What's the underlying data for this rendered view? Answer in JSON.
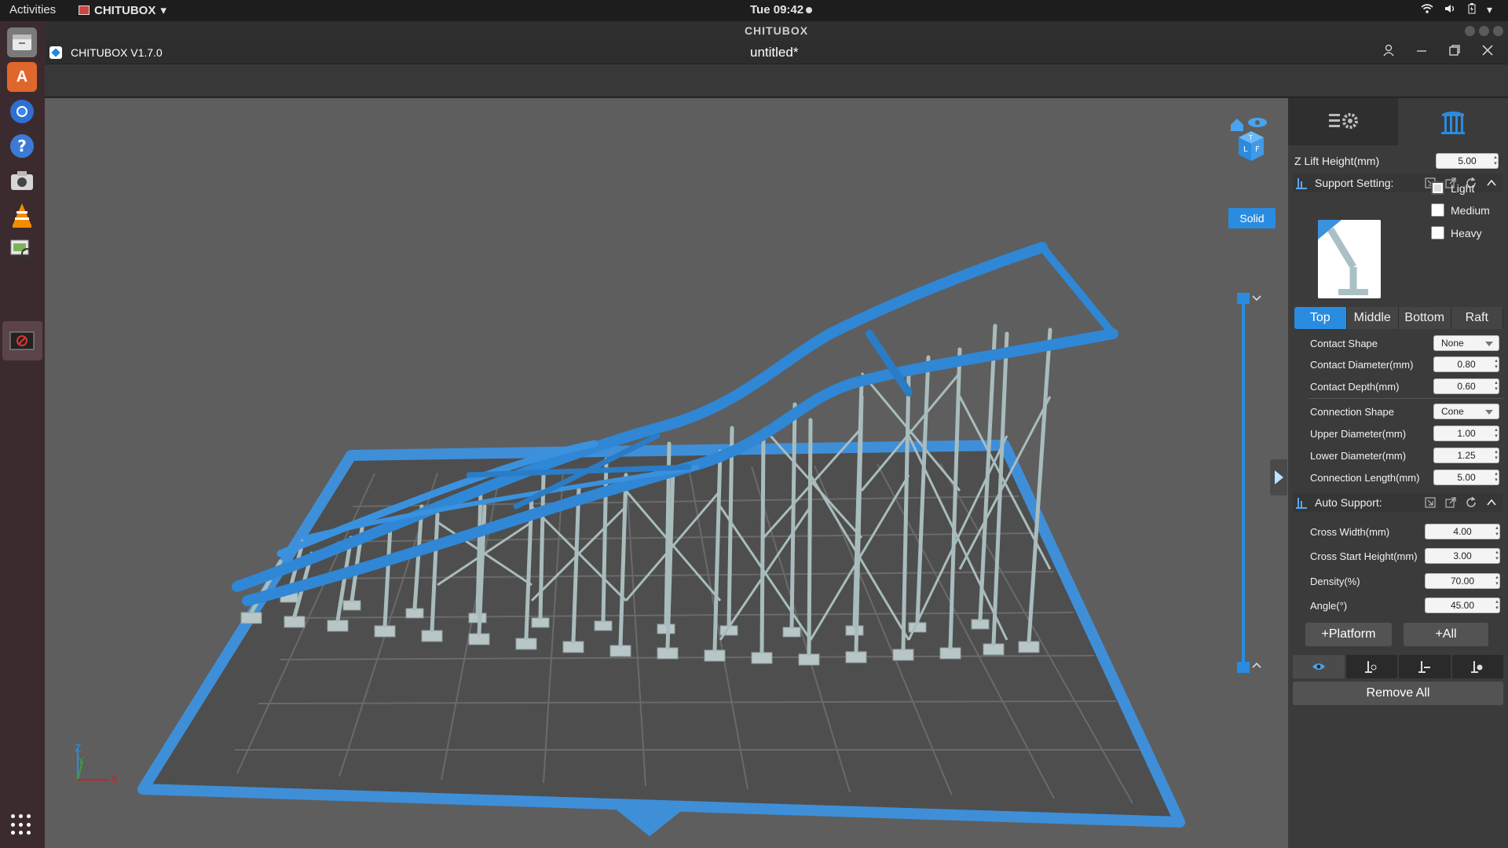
{
  "topbar": {
    "activities": "Activities",
    "app_menu": "CHITUBOX",
    "clock": "Tue 09:42"
  },
  "window": {
    "title": "CHITUBOX"
  },
  "app": {
    "name": "CHITUBOX V1.7.0",
    "document": "untitled*"
  },
  "viewport": {
    "render_mode": "Solid",
    "axis_z": "Z",
    "axis_y": "Y",
    "axis_x": "X",
    "accent_color": "#2a8ce0",
    "support_color": "#a9bcbd",
    "model_color": "#2f87d6"
  },
  "panel": {
    "z_lift": {
      "label": "Z Lift Height(mm)",
      "value": "5.00"
    },
    "support_setting": {
      "title": "Support Setting:",
      "presets": [
        {
          "label": "Light",
          "checked": true
        },
        {
          "label": "Medium",
          "checked": false
        },
        {
          "label": "Heavy",
          "checked": false
        }
      ],
      "tabs": [
        "Top",
        "Middle",
        "Bottom",
        "Raft"
      ],
      "active_tab": "Top",
      "fields": {
        "contact_shape": {
          "label": "Contact Shape",
          "value": "None"
        },
        "contact_diameter": {
          "label": "Contact Diameter(mm)",
          "value": "0.80"
        },
        "contact_depth": {
          "label": "Contact Depth(mm)",
          "value": "0.60"
        },
        "connection_shape": {
          "label": "Connection Shape",
          "value": "Cone"
        },
        "upper_diameter": {
          "label": "Upper Diameter(mm)",
          "value": "1.00"
        },
        "lower_diameter": {
          "label": "Lower Diameter(mm)",
          "value": "1.25"
        },
        "connection_length": {
          "label": "Connection Length(mm)",
          "value": "5.00"
        }
      }
    },
    "auto_support": {
      "title": "Auto Support:",
      "fields": {
        "cross_width": {
          "label": "Cross Width(mm)",
          "value": "4.00"
        },
        "cross_start_height": {
          "label": "Cross Start Height(mm)",
          "value": "3.00"
        },
        "density": {
          "label": "Density(%)",
          "value": "70.00"
        },
        "angle": {
          "label": "Angle(°)",
          "value": "45.00"
        }
      }
    },
    "buttons": {
      "platform": "+Platform",
      "all": "+All",
      "remove_all": "Remove All"
    }
  }
}
